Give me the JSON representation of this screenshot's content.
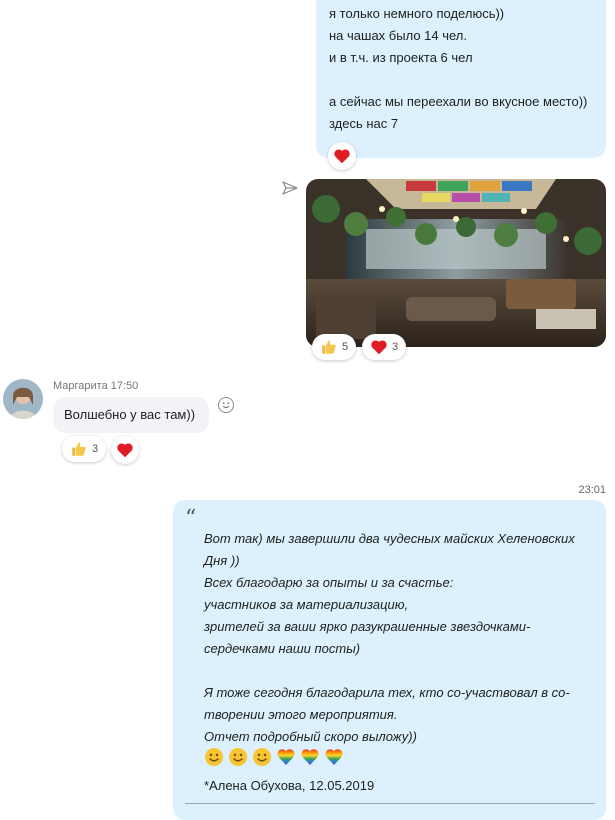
{
  "messages": [
    {
      "type": "outgoing-text",
      "lines": [
        "я только немного поделюсь))",
        "на чашах было 14 чел.",
        "и в т.ч. из проекта 6 чел",
        "",
        "а сейчас мы переехали во вкусное место))",
        "здесь нас 7"
      ],
      "reactions": [
        {
          "icon": "heart-icon",
          "count": ""
        }
      ]
    },
    {
      "type": "outgoing-photo",
      "status_icon": "sent-icon",
      "reactions": [
        {
          "icon": "thumbs-up-icon",
          "count": "5"
        },
        {
          "icon": "heart-icon",
          "count": "3"
        }
      ]
    },
    {
      "type": "incoming-text",
      "sender": "Маргарита",
      "time": "17:50",
      "sender_line": "Маргарита 17:50",
      "text": "Волшебно у вас там))",
      "reactions": [
        {
          "icon": "thumbs-up-icon",
          "count": "3"
        },
        {
          "icon": "heart-icon",
          "count": ""
        }
      ]
    },
    {
      "type": "outgoing-quote",
      "time": "23:01",
      "quote_lines": [
        "Вот так) мы завершили два чудесных майских Хеленовских",
        "Дня ))",
        "Всех благодарю за опыты и за счастье:",
        "участников за материализацию,",
        "зрителей за ваши ярко разукрашенные звездочками-",
        "сердечками наши посты)",
        "",
        "Я тоже сегодня благодарила тех, кто со-участвовал в со-",
        "творении этого мероприятия.",
        "Отчет подробный скоро выложу))"
      ],
      "emojis": [
        "smile-emoji",
        "smile-emoji",
        "smile-emoji",
        "rainbow-heart-emoji",
        "rainbow-heart-emoji",
        "rainbow-heart-emoji"
      ],
      "signature": "*Алена Обухова, 12.05.2019"
    }
  ],
  "colors": {
    "outgoing_bubble": "#dcf1fd",
    "incoming_bubble": "#f1f3f6",
    "heart": "#e01b24"
  }
}
